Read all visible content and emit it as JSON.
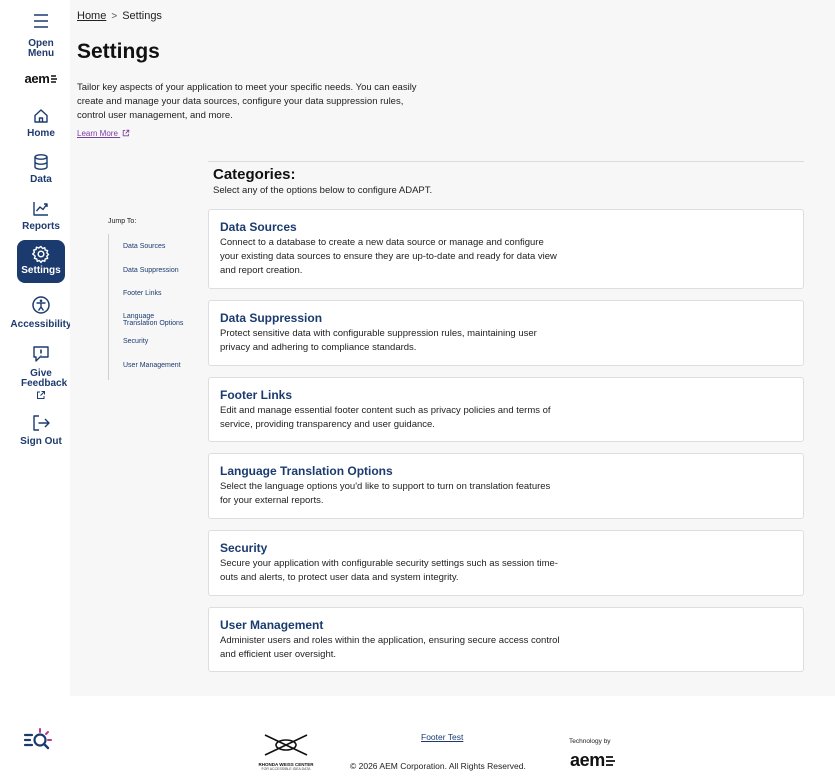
{
  "sidebar": {
    "open_menu": "Open Menu",
    "logo": "aem",
    "items": [
      {
        "label": "Home",
        "icon": "home-icon"
      },
      {
        "label": "Data",
        "icon": "database-icon"
      },
      {
        "label": "Reports",
        "icon": "chart-icon"
      },
      {
        "label": "Settings",
        "icon": "gear-icon",
        "active": true
      },
      {
        "label": "Accessibility",
        "icon": "accessibility-icon"
      },
      {
        "label": "Give Feedback",
        "icon": "feedback-icon"
      },
      {
        "label": "Sign Out",
        "icon": "sign-out-icon"
      }
    ]
  },
  "breadcrumb": {
    "home": "Home",
    "separator": ">",
    "current": "Settings"
  },
  "page": {
    "title": "Settings",
    "intro": "Tailor key aspects of your application to meet your specific needs. You can easily create and manage your data sources, configure your data suppression rules, control user management, and more.",
    "learn_more": "Learn More"
  },
  "categories": {
    "title": "Categories:",
    "subtitle": "Select any of the options below to configure ADAPT."
  },
  "jump_to": {
    "label": "Jump To:",
    "items": [
      "Data Sources",
      "Data Suppression",
      "Footer Links",
      "Language Translation Options",
      "Security",
      "User Management"
    ]
  },
  "cards": [
    {
      "title": "Data Sources",
      "description": "Connect to a database to create a new data source or manage and configure your existing data sources to ensure they are up-to-date and ready for data view and report creation."
    },
    {
      "title": "Data Suppression",
      "description": "Protect sensitive data with configurable suppression rules, maintaining user privacy and adhering to compliance standards."
    },
    {
      "title": "Footer Links",
      "description": "Edit and manage essential footer content such as privacy policies and terms of service, providing transparency and user guidance."
    },
    {
      "title": "Language Translation Options",
      "description": "Select the language options you'd like to support to turn on translation features for your external reports."
    },
    {
      "title": "Security",
      "description": "Secure your application with configurable security settings such as session time-outs and alerts, to protect user data and system integrity."
    },
    {
      "title": "User Management",
      "description": "Administer users and roles within the application, ensuring secure access control and efficient user oversight."
    }
  ],
  "footer": {
    "link": "Footer Test",
    "copyright": "© 2026 AEM Corporation. All Rights Reserved.",
    "tech_by": "Technology by",
    "tech_logo": "aem",
    "partner_name": "RHONDA WEISS CENTER",
    "partner_tagline": "FOR ACCESSIBLE IDEA DATA"
  },
  "colors": {
    "primary": "#1b3b6f",
    "link_purple": "#7a3fa0",
    "background": "#f7f7f7"
  }
}
